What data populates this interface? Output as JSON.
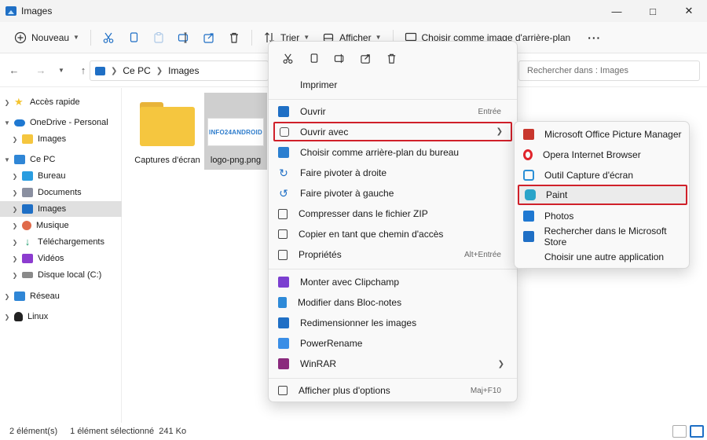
{
  "window": {
    "title": "Images"
  },
  "toolbar": {
    "new_label": "Nouveau",
    "sort_label": "Trier",
    "view_label": "Afficher",
    "wallpaper_label": "Choisir comme image d'arrière-plan",
    "more_label": "···"
  },
  "address": {
    "crumbs": [
      "Ce PC",
      "Images"
    ],
    "search_placeholder": "Rechercher dans : Images"
  },
  "sidebar": {
    "items": [
      {
        "label": "Accès rapide",
        "icon": "star-icon",
        "color": "#f4c430"
      },
      {
        "label": "OneDrive - Personal",
        "icon": "cloud-icon",
        "color": "#1f78d1"
      },
      {
        "label": "Images",
        "icon": "folder-icon",
        "color": "#f5c63f"
      },
      {
        "label": "Ce PC",
        "icon": "computer-icon",
        "color": "#2f86d6"
      },
      {
        "label": "Bureau",
        "icon": "desktop-icon",
        "color": "#2a9de0"
      },
      {
        "label": "Documents",
        "icon": "documents-icon",
        "color": "#8a8fa0"
      },
      {
        "label": "Images",
        "icon": "pictures-icon",
        "color": "#1f6fc5"
      },
      {
        "label": "Musique",
        "icon": "music-icon",
        "color": "#e06a4a"
      },
      {
        "label": "Téléchargements",
        "icon": "download-icon",
        "color": "#1a9b6a"
      },
      {
        "label": "Vidéos",
        "icon": "video-icon",
        "color": "#8c3ccf"
      },
      {
        "label": "Disque local (C:)",
        "icon": "drive-icon",
        "color": "#8a8a8a"
      },
      {
        "label": "Réseau",
        "icon": "network-icon",
        "color": "#2f86d6"
      },
      {
        "label": "Linux",
        "icon": "linux-icon",
        "color": "#222222"
      }
    ]
  },
  "files": [
    {
      "name": "Captures d'écran",
      "type": "folder"
    },
    {
      "name": "logo-png.png",
      "type": "image",
      "thumb_text": "INFO24ANDROID"
    }
  ],
  "status": {
    "count": "2 élément(s)",
    "selection": "1 élément sélectionné  241 Ko"
  },
  "context_menu": {
    "items": [
      {
        "label": "Imprimer",
        "icon": "",
        "shortcut": ""
      },
      {
        "label": "Ouvrir",
        "icon": "open-icon",
        "shortcut": "Entrée"
      },
      {
        "label": "Ouvrir avec",
        "icon": "open-with-icon",
        "shortcut": "",
        "submenu": true
      },
      {
        "label": "Choisir comme arrière-plan du bureau",
        "icon": "wallpaper-icon",
        "shortcut": ""
      },
      {
        "label": "Faire pivoter à droite",
        "icon": "rotate-right-icon",
        "shortcut": ""
      },
      {
        "label": "Faire pivoter à gauche",
        "icon": "rotate-left-icon",
        "shortcut": ""
      },
      {
        "label": "Compresser dans le fichier ZIP",
        "icon": "zip-icon",
        "shortcut": ""
      },
      {
        "label": "Copier en tant que chemin d'accès",
        "icon": "copy-path-icon",
        "shortcut": ""
      },
      {
        "label": "Propriétés",
        "icon": "properties-icon",
        "shortcut": "Alt+Entrée"
      },
      {
        "label": "Monter avec Clipchamp",
        "icon": "clipchamp-icon",
        "shortcut": ""
      },
      {
        "label": "Modifier dans Bloc-notes",
        "icon": "notepad-icon",
        "shortcut": ""
      },
      {
        "label": "Redimensionner les images",
        "icon": "resize-icon",
        "shortcut": ""
      },
      {
        "label": "PowerRename",
        "icon": "powerrename-icon",
        "shortcut": ""
      },
      {
        "label": "WinRAR",
        "icon": "winrar-icon",
        "shortcut": "",
        "submenu": true
      },
      {
        "label": "Afficher plus d'options",
        "icon": "more-options-icon",
        "shortcut": "Maj+F10"
      }
    ]
  },
  "open_with_menu": {
    "items": [
      {
        "label": "Microsoft Office Picture Manager",
        "icon": "picture-manager-icon",
        "color": "#c8362d"
      },
      {
        "label": "Opera Internet Browser",
        "icon": "opera-icon",
        "color": "#e0242b"
      },
      {
        "label": "Outil Capture d'écran",
        "icon": "snipping-tool-icon",
        "color": "#2b8fd6"
      },
      {
        "label": "Paint",
        "icon": "paint-icon",
        "color": "#2aa4c9"
      },
      {
        "label": "Photos",
        "icon": "photos-icon",
        "color": "#1f78d1"
      },
      {
        "label": "Rechercher dans le Microsoft Store",
        "icon": "store-icon",
        "color": "#1f6fc5"
      },
      {
        "label": "Choisir une autre application",
        "icon": "",
        "color": ""
      }
    ]
  },
  "colors": {
    "highlight_border": "#d0202a",
    "accent": "#1f6fc5"
  }
}
